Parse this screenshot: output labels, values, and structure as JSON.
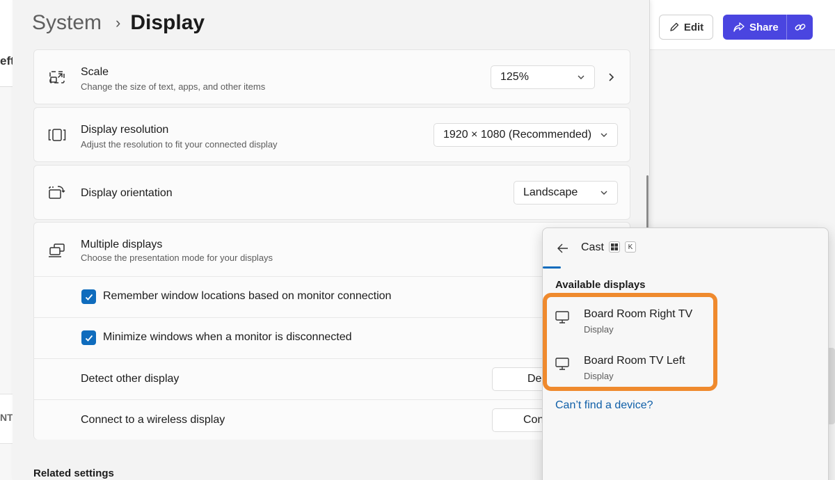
{
  "background": {
    "left_text_top": "eft",
    "left_text_bottom": "NT",
    "edit_label": "Edit",
    "share_label": "Share"
  },
  "settings": {
    "breadcrumb_parent": "System",
    "breadcrumb_separator": "›",
    "breadcrumb_current": "Display",
    "scale": {
      "title": "Scale",
      "subtitle": "Change the size of text, apps, and other items",
      "value": "125%"
    },
    "resolution": {
      "title": "Display resolution",
      "subtitle": "Adjust the resolution to fit your connected display",
      "value": "1920 × 1080 (Recommended)"
    },
    "orientation": {
      "title": "Display orientation",
      "value": "Landscape"
    },
    "multiple": {
      "title": "Multiple displays",
      "subtitle": "Choose the presentation mode for your displays",
      "remember_label": "Remember window locations based on monitor connection",
      "remember_checked": true,
      "minimize_label": "Minimize windows when a monitor is disconnected",
      "minimize_checked": true,
      "detect_label": "Detect other display",
      "detect_button": "De",
      "connect_label": "Connect to a wireless display",
      "connect_button": "Con"
    },
    "related_heading": "Related settings"
  },
  "cast": {
    "title": "Cast",
    "shortcut_key": "K",
    "section_heading": "Available displays",
    "devices": [
      {
        "name": "Board Room Right TV",
        "type": "Display"
      },
      {
        "name": "Board Room TV Left",
        "type": "Display"
      }
    ],
    "help_link": "Can’t find a device?"
  },
  "colors": {
    "accent": "#0f6cbd",
    "highlight": "#ef8a2e",
    "share_button": "#4a45e0"
  }
}
